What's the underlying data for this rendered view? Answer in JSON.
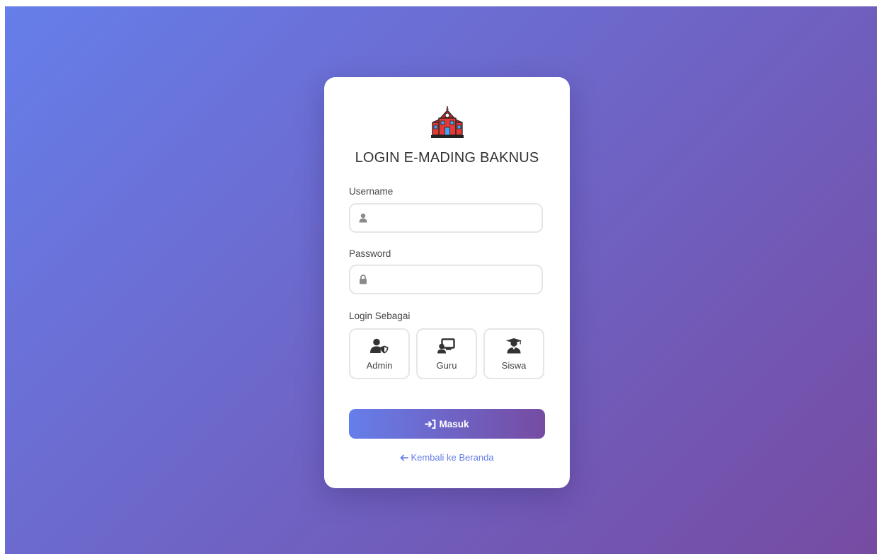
{
  "page": {
    "title": "LOGIN E-MADING BAKNUS",
    "logo_icon": "school-building-icon"
  },
  "form": {
    "username": {
      "label": "Username",
      "value": "",
      "placeholder": "",
      "icon": "user-icon"
    },
    "password": {
      "label": "Password",
      "value": "",
      "placeholder": "",
      "icon": "lock-icon"
    },
    "role": {
      "label": "Login Sebagai",
      "options": [
        {
          "label": "Admin",
          "icon": "user-shield-icon"
        },
        {
          "label": "Guru",
          "icon": "chalkboard-teacher-icon"
        },
        {
          "label": "Siswa",
          "icon": "user-graduate-icon"
        }
      ]
    },
    "submit_label": "Masuk",
    "submit_icon": "sign-in-icon"
  },
  "back_link": {
    "label": "Kembali ke Beranda",
    "icon": "arrow-left-icon"
  },
  "colors": {
    "gradient_start": "#667eea",
    "gradient_end": "#764ba2",
    "card": "#ffffff",
    "text": "#333333"
  }
}
